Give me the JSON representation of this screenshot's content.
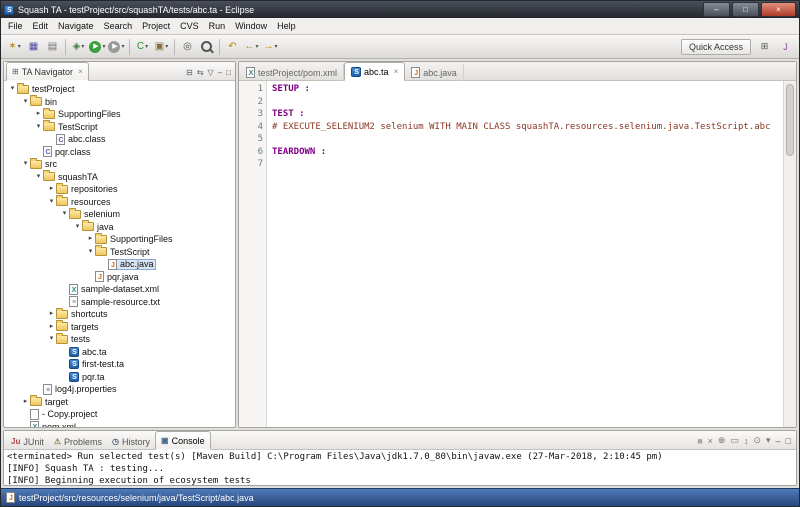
{
  "window": {
    "title": "Squash TA - testProject/src/squashTA/tests/abc.ta - Eclipse",
    "controls": [
      {
        "name": "minimize",
        "glyph": "–"
      },
      {
        "name": "maximize",
        "glyph": "□"
      },
      {
        "name": "close",
        "glyph": "×"
      }
    ]
  },
  "glyphs": {
    "close": "×",
    "dropdown": "▾",
    "expander_open": "▾",
    "expander_closed": "▸"
  },
  "colors": {
    "keyword": "#7f0082",
    "macro": "#8b3626",
    "line_number": "#5f8575",
    "selection_bg": "#d9e6f5",
    "selection_border": "#8aaad2",
    "status_bar_top": "#4f79b8",
    "status_bar_bottom": "#27477d"
  },
  "menu": {
    "items": [
      "File",
      "Edit",
      "Navigate",
      "Search",
      "Project",
      "CVS",
      "Run",
      "Window",
      "Help"
    ]
  },
  "toolbar": {
    "quick_access_label": "Quick Access",
    "groups": [
      [
        {
          "name": "new-wizard",
          "glyph": "✶",
          "color": "#c08a2e",
          "dropdown": true
        },
        {
          "name": "save",
          "glyph": "▦",
          "color": "#4a4aa8"
        },
        {
          "name": "print",
          "glyph": "▤",
          "color": "#707070"
        }
      ],
      [
        {
          "name": "debug",
          "glyph": "◈",
          "color": "#3e7d3e",
          "dropdown": true
        },
        {
          "name": "run",
          "glyph": "▶",
          "color": "#ffffff",
          "bg": "#3da13d",
          "round": true,
          "dropdown": true
        },
        {
          "name": "external-tools",
          "glyph": "▶",
          "color": "#ffffff",
          "bg": "#9a9a9a",
          "round": true,
          "dropdown": true
        }
      ],
      [
        {
          "name": "new-java-class",
          "glyph": "C",
          "color": "#2f8f2f",
          "dropdown": true
        },
        {
          "name": "new-java-package",
          "glyph": "▣",
          "color": "#8a6d3b",
          "dropdown": true
        }
      ],
      [
        {
          "name": "open-type",
          "glyph": "◎",
          "color": "#555555"
        },
        {
          "name": "search",
          "css": "mag"
        }
      ],
      [
        {
          "name": "last-edit-location",
          "glyph": "↶",
          "color": "#b8860b"
        },
        {
          "name": "back",
          "glyph": "←",
          "color": "#b8860b",
          "dropdown": true
        },
        {
          "name": "forward",
          "glyph": "→",
          "color": "#b8860b",
          "dropdown": true
        }
      ]
    ],
    "right_icons": [
      {
        "name": "open-perspective",
        "glyph": "⊞",
        "color": "#555555"
      },
      {
        "name": "java-perspective",
        "glyph": "J",
        "color": "#8a4b9c"
      }
    ]
  },
  "icons": {
    "project": {
      "kind": "folder"
    },
    "folder": {
      "kind": "folder"
    },
    "class": {
      "kind": "file",
      "letter": "C",
      "color": "#5c5cb8"
    },
    "java": {
      "kind": "file",
      "letter": "J",
      "color": "#c26f1f"
    },
    "ta": {
      "kind": "ta",
      "letter": "S"
    },
    "xml": {
      "kind": "file",
      "letter": "X",
      "color": "#2e8b8b"
    },
    "txt": {
      "kind": "file",
      "letter": "≡",
      "color": "#888888"
    },
    "props": {
      "kind": "file",
      "letter": "≡",
      "color": "#5577aa"
    },
    "file": {
      "kind": "file"
    }
  },
  "navigator": {
    "tab_label": "TA Navigator",
    "tab_icon": "⊞",
    "toolbar": [
      {
        "name": "collapse-all",
        "glyph": "⊟",
        "color": "#556"
      },
      {
        "name": "link-with-editor",
        "glyph": "⇆",
        "color": "#556"
      },
      {
        "name": "view-menu",
        "glyph": "▽",
        "color": "#556"
      },
      {
        "name": "minimize-view",
        "glyph": "–",
        "color": "#555"
      },
      {
        "name": "maximize-view",
        "glyph": "□",
        "color": "#555"
      }
    ],
    "tree": [
      {
        "label": "testProject",
        "level": 0,
        "exp": "open",
        "icon": "project"
      },
      {
        "label": "bin",
        "level": 1,
        "exp": "open",
        "icon": "folder"
      },
      {
        "label": "SupportingFiles",
        "level": 2,
        "exp": "closed",
        "icon": "folder"
      },
      {
        "label": "TestScript",
        "level": 2,
        "exp": "open",
        "icon": "folder"
      },
      {
        "label": "abc.class",
        "level": 3,
        "exp": null,
        "icon": "class"
      },
      {
        "label": "pqr.class",
        "level": 2,
        "exp": null,
        "icon": "class"
      },
      {
        "label": "src",
        "level": 1,
        "exp": "open",
        "icon": "folder"
      },
      {
        "label": "squashTA",
        "level": 2,
        "exp": "open",
        "icon": "folder"
      },
      {
        "label": "repositories",
        "level": 3,
        "exp": "closed",
        "icon": "folder"
      },
      {
        "label": "resources",
        "level": 3,
        "exp": "open",
        "icon": "folder"
      },
      {
        "label": "selenium",
        "level": 4,
        "exp": "open",
        "icon": "folder"
      },
      {
        "label": "java",
        "level": 5,
        "exp": "open",
        "icon": "folder"
      },
      {
        "label": "SupportingFiles",
        "level": 6,
        "exp": "closed",
        "icon": "folder"
      },
      {
        "label": "TestScript",
        "level": 6,
        "exp": "open",
        "icon": "folder"
      },
      {
        "label": "abc.java",
        "level": 7,
        "exp": null,
        "icon": "java",
        "selected": true
      },
      {
        "label": "pqr.java",
        "level": 6,
        "exp": null,
        "icon": "java"
      },
      {
        "label": "sample-dataset.xml",
        "level": 4,
        "exp": null,
        "icon": "xml"
      },
      {
        "label": "sample-resource.txt",
        "level": 4,
        "exp": null,
        "icon": "txt"
      },
      {
        "label": "shortcuts",
        "level": 3,
        "exp": "closed",
        "icon": "folder"
      },
      {
        "label": "targets",
        "level": 3,
        "exp": "closed",
        "icon": "folder"
      },
      {
        "label": "tests",
        "level": 3,
        "exp": "open",
        "icon": "folder"
      },
      {
        "label": "abc.ta",
        "level": 4,
        "exp": null,
        "icon": "ta"
      },
      {
        "label": "first-test.ta",
        "level": 4,
        "exp": null,
        "icon": "ta"
      },
      {
        "label": "pqr.ta",
        "level": 4,
        "exp": null,
        "icon": "ta"
      },
      {
        "label": "log4j.properties",
        "level": 2,
        "exp": null,
        "icon": "props"
      },
      {
        "label": "target",
        "level": 1,
        "exp": "closed",
        "icon": "folder"
      },
      {
        "label": "- Copy.project",
        "level": 1,
        "exp": null,
        "icon": "file"
      },
      {
        "label": "pom.xml",
        "level": 1,
        "exp": null,
        "icon": "xml"
      }
    ]
  },
  "editor": {
    "tabs": [
      {
        "label": "testProject/pom.xml",
        "icon": "xml",
        "active": false,
        "closable": false
      },
      {
        "label": "abc.ta",
        "icon": "ta",
        "active": true,
        "closable": true
      },
      {
        "label": "abc.java",
        "icon": "java",
        "active": false,
        "closable": false
      }
    ],
    "lines": [
      {
        "num": 1,
        "text": "SETUP :",
        "type": "keyword"
      },
      {
        "num": 2,
        "text": "",
        "type": "plain"
      },
      {
        "num": 3,
        "text": "TEST :",
        "type": "keyword"
      },
      {
        "num": 4,
        "text": "# EXECUTE_SELENIUM2 selenium WITH MAIN CLASS squashTA.resources.selenium.java.TestScript.abc",
        "type": "macro"
      },
      {
        "num": 5,
        "text": "",
        "type": "plain"
      },
      {
        "num": 6,
        "text": "TEARDOWN :",
        "type": "keyword"
      },
      {
        "num": 7,
        "text": "",
        "type": "plain"
      }
    ]
  },
  "bottom_panel": {
    "tabs": [
      {
        "label": "JUnit",
        "icon_glyph": "Ju",
        "icon_color": "#b04545",
        "active": false
      },
      {
        "label": "Problems",
        "icon_glyph": "⚠",
        "icon_color": "#8a8a4a",
        "active": false
      },
      {
        "label": "History",
        "icon_glyph": "◷",
        "icon_color": "#556688",
        "active": false
      },
      {
        "label": "Console",
        "icon_glyph": "▣",
        "icon_color": "#46698c",
        "active": true
      }
    ],
    "toolbar": [
      {
        "name": "terminate",
        "glyph": "■",
        "color": "#a8a6a3"
      },
      {
        "name": "remove-launch",
        "glyph": "×",
        "color": "#777777"
      },
      {
        "name": "remove-all-launches",
        "glyph": "⊗",
        "color": "#777777"
      },
      {
        "name": "clear-console",
        "glyph": "▭",
        "color": "#777777"
      },
      {
        "name": "scroll-lock",
        "glyph": "↕",
        "color": "#777777"
      },
      {
        "name": "pin-console",
        "glyph": "⊙",
        "color": "#777777"
      },
      {
        "name": "console-menu",
        "glyph": "▾",
        "color": "#777777"
      },
      {
        "name": "minimize-view",
        "glyph": "–",
        "color": "#555555"
      },
      {
        "name": "maximize-view",
        "glyph": "□",
        "color": "#555555"
      }
    ],
    "console": {
      "header": "<terminated> Run selected test(s) [Maven Build] C:\\Program Files\\Java\\jdk1.7.0_80\\bin\\javaw.exe (27-Mar-2018, 2:10:45 pm)",
      "lines": [
        "[INFO] Squash TA : testing...",
        "[INFO] Beginning execution of ecosystem tests"
      ]
    }
  },
  "status_bar": {
    "text": "testProject/src/resources/selenium/java/TestScript/abc.java"
  }
}
